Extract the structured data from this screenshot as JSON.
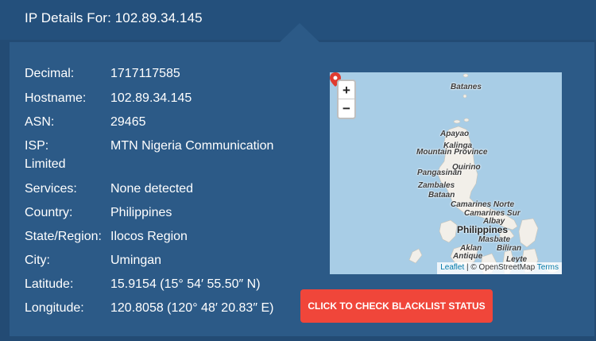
{
  "header": {
    "title": "IP Details For: 102.89.34.145"
  },
  "details": [
    {
      "label": "Decimal:",
      "value": "1717117585"
    },
    {
      "label": "Hostname:",
      "value": "102.89.34.145"
    },
    {
      "label": "ASN:",
      "value": "29465"
    },
    {
      "label": "ISP:",
      "value": "MTN Nigeria Communication",
      "value_cont": "Limited"
    },
    {
      "label": "Services:",
      "value": "None detected"
    },
    {
      "label": "Country:",
      "value": "Philippines"
    },
    {
      "label": "State/Region:",
      "value": "Ilocos Region"
    },
    {
      "label": "City:",
      "value": "Umingan"
    },
    {
      "label": "Latitude:",
      "value": "15.9154 (15° 54′ 55.50″ N)"
    },
    {
      "label": "Longitude:",
      "value": "120.8058 (120° 48′ 20.83″ E)"
    }
  ],
  "map": {
    "zoom_in": "+",
    "zoom_out": "−",
    "labels": [
      "Batanes",
      "Apayao",
      "Kalinga",
      "Mountain Province",
      "Quirino",
      "Pangasinan",
      "Zambales",
      "Bataan",
      "Camarines Norte",
      "Camarines Sur",
      "Albay",
      "Philippines",
      "Masbate",
      "Aklan",
      "Biliran",
      "Antique",
      "Leyte"
    ],
    "attribution": {
      "leaflet": "Leaflet",
      "sep": "|",
      "osm": "© OpenStreetMap",
      "terms": "Terms"
    },
    "colors": {
      "water": "#a8cde6",
      "land": "#f2efe9",
      "marker": "#e03b2f"
    }
  },
  "actions": {
    "blacklist_button": "CLICK TO CHECK BLACKLIST STATUS"
  },
  "colors": {
    "background": "#234b74",
    "panel": "#2c5a87",
    "button": "#f0463a"
  }
}
